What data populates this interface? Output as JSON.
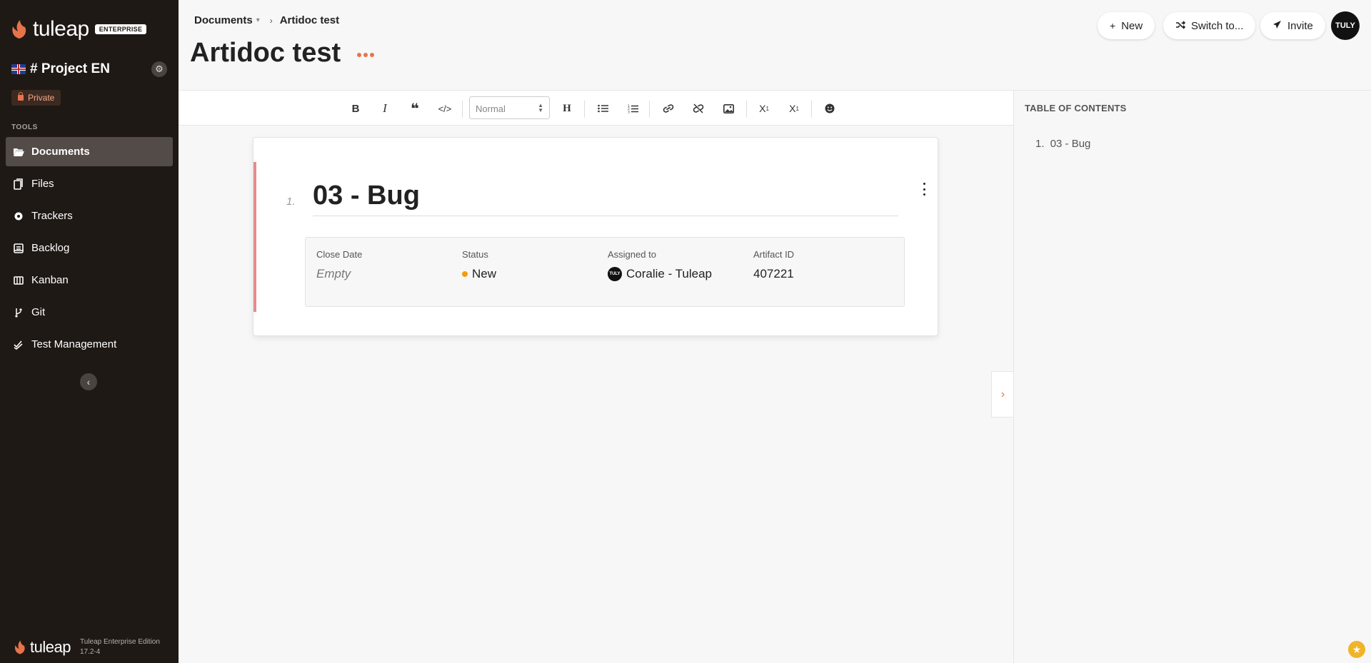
{
  "brand": {
    "logo_text": "tuleap",
    "edition_badge": "ENTERPRISE",
    "accent": "#e8734a"
  },
  "sidebar": {
    "project_name": "# Project EN",
    "privacy": "Private",
    "tools_label": "TOOLS",
    "items": [
      {
        "label": "Documents",
        "icon": "folder-open-icon",
        "active": true
      },
      {
        "label": "Files",
        "icon": "files-icon"
      },
      {
        "label": "Trackers",
        "icon": "tracker-icon"
      },
      {
        "label": "Backlog",
        "icon": "backlog-icon"
      },
      {
        "label": "Kanban",
        "icon": "kanban-icon"
      },
      {
        "label": "Git",
        "icon": "git-branch-icon"
      },
      {
        "label": "Test Management",
        "icon": "check-double-icon"
      }
    ],
    "footer_logo": "tuleap",
    "edition_line1": "Tuleap Enterprise Edition",
    "edition_line2": "17.2-4"
  },
  "header": {
    "breadcrumb": [
      "Documents",
      "Artidoc test"
    ],
    "title": "Artidoc test",
    "buttons": {
      "new": "New",
      "switch": "Switch to...",
      "invite": "Invite"
    },
    "avatar_initials": "TULY"
  },
  "toolbar": {
    "format_select": "Normal",
    "buttons": [
      "bold-icon",
      "italic-icon",
      "quote-icon",
      "code-icon",
      "heading-icon",
      "bullet-list-icon",
      "ordered-list-icon",
      "link-icon",
      "unlink-icon",
      "image-icon",
      "subscript-icon",
      "superscript-icon",
      "emoji-icon"
    ]
  },
  "section": {
    "number": "1.",
    "title": "03 - Bug",
    "fields": [
      {
        "label": "Close Date",
        "value": "Empty"
      },
      {
        "label": "Status",
        "value": "New",
        "color": "#f39c12"
      },
      {
        "label": "Assigned to",
        "value": "Coralie - Tuleap",
        "avatar": "TULY"
      },
      {
        "label": "Artifact ID",
        "value": "407221"
      }
    ]
  },
  "toc": {
    "title": "TABLE OF CONTENTS",
    "items": [
      {
        "num": "1.",
        "label": "03 - Bug"
      }
    ]
  }
}
